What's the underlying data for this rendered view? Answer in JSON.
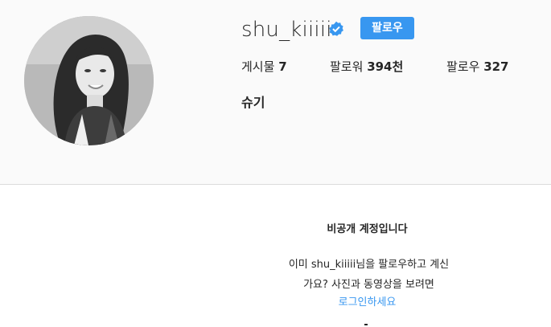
{
  "profile": {
    "username": "shu_kiiiii",
    "follow_label": "팔로우",
    "full_name": "슈기",
    "stats": {
      "posts_label": "게시물",
      "posts_count": "7",
      "followers_label": "팔로워",
      "followers_count": "394천",
      "following_label": "팔로우",
      "following_count": "327"
    }
  },
  "private_notice": {
    "title": "비공개 계정입니다",
    "message_line1": "이미 shu_kiiiii님을 팔로우하고 계신",
    "message_line2": "가요? 사진과 동영상을 보려면",
    "login_link": "로그인하세요"
  },
  "colors": {
    "accent": "#3897f0",
    "text": "#262626",
    "header_bg": "#fafafa",
    "content_bg": "#ffffff"
  },
  "icons": {
    "verified": "verified-badge-icon"
  }
}
